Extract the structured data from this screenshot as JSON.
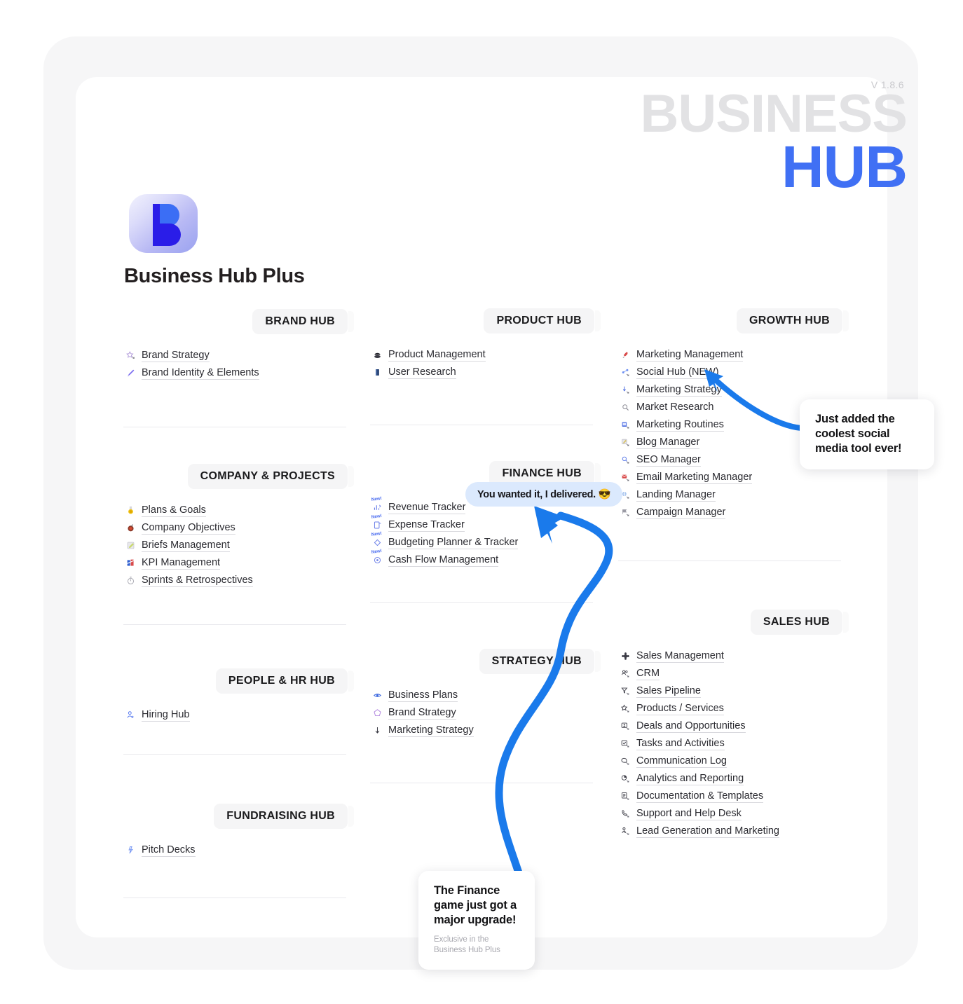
{
  "header": {
    "version": "V 1.8.6",
    "brand_line1": "BUSINESS",
    "brand_line2": "HUB",
    "app_title": "Business Hub Plus"
  },
  "colors": {
    "brand_blue": "#4070f4",
    "brand_gray": "#e2e2e4",
    "arrow_blue": "#1a7aeb",
    "bubble_bg": "#dbe9fd",
    "badge_bg": "#f5f5f6",
    "divider": "#e9e9ed"
  },
  "columns": [
    {
      "name": "column-left",
      "hubs": [
        {
          "title": "BRAND HUB",
          "items": [
            {
              "label": "Brand Strategy",
              "icon": "star-arrow-icon",
              "new": false
            },
            {
              "label": "Brand Identity & Elements",
              "icon": "paintbrush-icon",
              "new": false
            }
          ]
        },
        {
          "title": "COMPANY & PROJECTS",
          "items": [
            {
              "label": "Plans & Goals",
              "icon": "medal-icon",
              "new": false
            },
            {
              "label": "Company Objectives",
              "icon": "target-icon",
              "new": false
            },
            {
              "label": "Briefs Management",
              "icon": "memo-icon",
              "new": false
            },
            {
              "label": "KPI Management",
              "icon": "chart-icon",
              "new": false
            },
            {
              "label": "Sprints & Retrospectives",
              "icon": "stopwatch-icon",
              "new": false
            }
          ]
        },
        {
          "title": "PEOPLE & HR HUB",
          "items": [
            {
              "label": "Hiring Hub",
              "icon": "person-plus-icon",
              "new": false
            }
          ]
        },
        {
          "title": "FUNDRAISING HUB",
          "items": [
            {
              "label": "Pitch Decks",
              "icon": "spark-arrow-icon",
              "new": false
            }
          ]
        }
      ]
    },
    {
      "name": "column-middle",
      "hubs": [
        {
          "title": "PRODUCT HUB",
          "items": [
            {
              "label": "Product Management",
              "icon": "package-icon",
              "new": false
            },
            {
              "label": "User Research",
              "icon": "book-icon",
              "new": false
            }
          ]
        },
        {
          "title": "FINANCE HUB",
          "items": [
            {
              "label": "Revenue Tracker",
              "icon": "trend-up-icon",
              "new": true,
              "new_label": "New!"
            },
            {
              "label": "Expense Tracker",
              "icon": "receipt-icon",
              "new": true,
              "new_label": "New!"
            },
            {
              "label": "Budgeting Planner & Tracker",
              "icon": "diamond-icon",
              "new": true,
              "new_label": "New!"
            },
            {
              "label": "Cash Flow Management",
              "icon": "coin-icon",
              "new": true,
              "new_label": "New!"
            }
          ]
        },
        {
          "title": "STRATEGY HUB",
          "items": [
            {
              "label": "Business Plans",
              "icon": "eye-icon",
              "new": false
            },
            {
              "label": "Brand Strategy",
              "icon": "pentagon-icon",
              "new": false
            },
            {
              "label": "Marketing Strategy",
              "icon": "arrow-down-icon",
              "new": false
            }
          ]
        }
      ]
    },
    {
      "name": "column-right",
      "hubs": [
        {
          "title": "GROWTH HUB",
          "items": [
            {
              "label": "Marketing Management",
              "icon": "rocket-icon",
              "new": false
            },
            {
              "label": "Social Hub (NEW)",
              "icon": "share-arrow-icon",
              "new": false
            },
            {
              "label": "Marketing Strategy",
              "icon": "download-arrow-icon",
              "new": false
            },
            {
              "label": "Market Research",
              "icon": "magnifier-icon",
              "new": false
            },
            {
              "label": "Marketing Routines",
              "icon": "calendar-arrow-icon",
              "new": false
            },
            {
              "label": "Blog Manager",
              "icon": "note-arrow-icon",
              "new": false
            },
            {
              "label": "SEO Manager",
              "icon": "search-arrow-icon",
              "new": false
            },
            {
              "label": "Email Marketing Manager",
              "icon": "mail-arrow-icon",
              "new": false
            },
            {
              "label": "Landing Manager",
              "icon": "globe-arrow-icon",
              "new": false
            },
            {
              "label": "Campaign Manager",
              "icon": "flag-arrow-icon",
              "new": false
            }
          ]
        },
        {
          "title": "SALES HUB",
          "items": [
            {
              "label": "Sales Management",
              "icon": "gear-flower-icon",
              "new": false
            },
            {
              "label": "CRM",
              "icon": "people-arrow-icon",
              "new": false
            },
            {
              "label": "Sales Pipeline",
              "icon": "funnel-arrow-icon",
              "new": false
            },
            {
              "label": "Products / Services",
              "icon": "star-outline-arrow-icon",
              "new": false
            },
            {
              "label": "Deals and Opportunities",
              "icon": "contact-card-arrow-icon",
              "new": false
            },
            {
              "label": "Tasks and Activities",
              "icon": "check-square-arrow-icon",
              "new": false
            },
            {
              "label": "Communication Log",
              "icon": "chat-arrow-icon",
              "new": false
            },
            {
              "label": "Analytics and Reporting",
              "icon": "pie-chart-arrow-icon",
              "new": false
            },
            {
              "label": "Documentation & Templates",
              "icon": "document-arrow-icon",
              "new": false
            },
            {
              "label": "Support and Help Desk",
              "icon": "phone-arrow-icon",
              "new": false
            },
            {
              "label": "Lead Generation and Marketing",
              "icon": "person-arrow-icon",
              "new": false
            }
          ]
        }
      ]
    }
  ],
  "bubble": {
    "text": "You wanted it, I delivered. 😎"
  },
  "callouts": [
    {
      "name": "callout-social",
      "title": "Just added the coolest social media tool ever!",
      "subtitle": ""
    },
    {
      "name": "callout-finance",
      "title": "The Finance game just got a major upgrade!",
      "subtitle": "Exclusive in the Business Hub Plus"
    }
  ]
}
